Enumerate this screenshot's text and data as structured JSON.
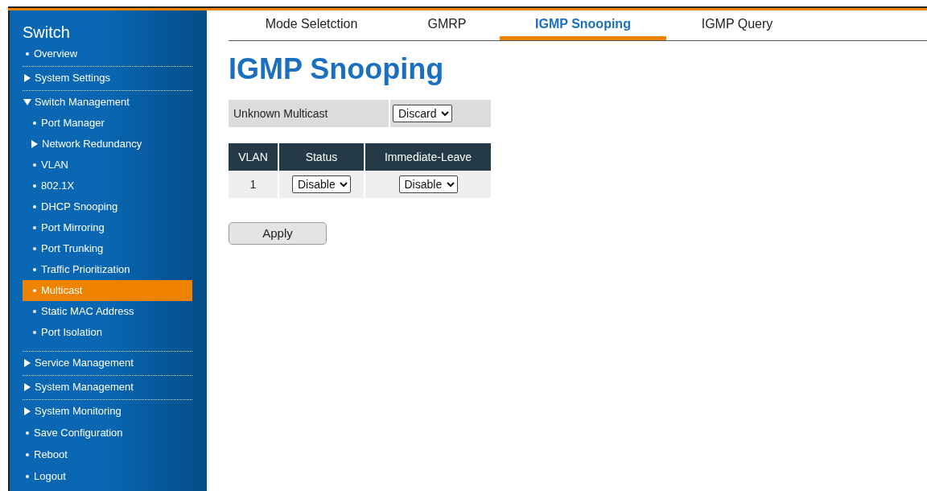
{
  "sidebar": {
    "title": "Switch",
    "items": [
      {
        "kind": "link",
        "label": "Overview",
        "selected": false,
        "divider": true
      },
      {
        "kind": "group",
        "label": "System Settings",
        "expanded": false,
        "divider": true
      },
      {
        "kind": "group",
        "label": "Switch Management",
        "expanded": true,
        "divider": true,
        "children": [
          {
            "kind": "link",
            "label": "Port Manager",
            "selected": false
          },
          {
            "kind": "group",
            "label": "Network Redundancy",
            "expanded": false
          },
          {
            "kind": "link",
            "label": "VLAN",
            "selected": false
          },
          {
            "kind": "link",
            "label": "802.1X",
            "selected": false
          },
          {
            "kind": "link",
            "label": "DHCP Snooping",
            "selected": false
          },
          {
            "kind": "link",
            "label": "Port Mirroring",
            "selected": false
          },
          {
            "kind": "link",
            "label": "Port Trunking",
            "selected": false
          },
          {
            "kind": "link",
            "label": "Traffic Prioritization",
            "selected": false
          },
          {
            "kind": "link",
            "label": "Multicast",
            "selected": true
          },
          {
            "kind": "link",
            "label": "Static MAC Address",
            "selected": false
          },
          {
            "kind": "link",
            "label": "Port Isolation",
            "selected": false
          }
        ]
      },
      {
        "kind": "group",
        "label": "Service Management",
        "expanded": false,
        "divider": true
      },
      {
        "kind": "group",
        "label": "System Management",
        "expanded": false,
        "divider": true
      },
      {
        "kind": "group",
        "label": "System Monitoring",
        "expanded": false,
        "divider": false
      },
      {
        "kind": "link",
        "label": "Save Configuration",
        "selected": false,
        "divider": false
      },
      {
        "kind": "link",
        "label": "Reboot",
        "selected": false,
        "divider": false
      },
      {
        "kind": "link",
        "label": "Logout",
        "selected": false,
        "divider": false
      }
    ]
  },
  "tabs": [
    {
      "label": "Mode Seletction",
      "selected": false
    },
    {
      "label": "GMRP",
      "selected": false
    },
    {
      "label": "IGMP Snooping",
      "selected": true
    },
    {
      "label": "IGMP Query",
      "selected": false
    }
  ],
  "heading": "IGMP Snooping",
  "settings": [
    {
      "label": "Unknown Multicast",
      "value": "Discard"
    }
  ],
  "vlan_table": {
    "columns": [
      "VLAN",
      "Status",
      "Immediate-Leave"
    ],
    "rows": [
      {
        "vlan": "1",
        "status": "Disable",
        "immediate_leave": "Disable"
      }
    ]
  },
  "apply_button": "Apply"
}
